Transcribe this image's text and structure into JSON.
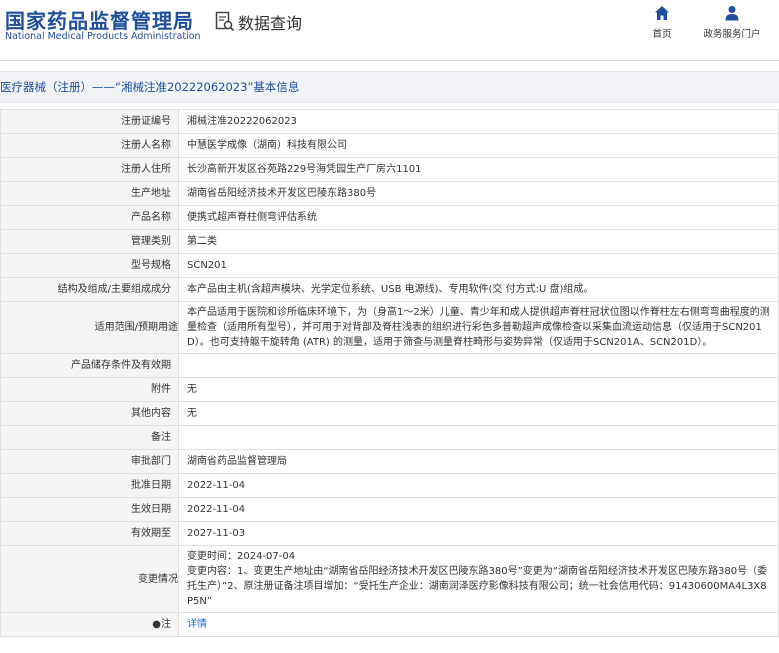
{
  "header": {
    "logo_cn": "国家药品监督管理局",
    "logo_en": "National Medical Products Administration",
    "query_title": "数据查询",
    "nav": [
      {
        "label": "首页",
        "icon": "home-icon"
      },
      {
        "label": "政务服务门户",
        "icon": "user-icon"
      }
    ]
  },
  "breadcrumb": "医疗器械（注册）——“湘械注准20222062023”基本信息",
  "colors": {
    "brand": "#1f4e9c",
    "link": "#1f6fd1",
    "label_bg": "#f5f5f5"
  },
  "rows": [
    {
      "label": "注册证编号",
      "value": "湘械注准20222062023"
    },
    {
      "label": "注册人名称",
      "value": "中慧医学成像（湖南）科技有限公司"
    },
    {
      "label": "注册人住所",
      "value": "长沙高新开发区谷苑路229号海凭园生产厂房六1101"
    },
    {
      "label": "生产地址",
      "value": "湖南省岳阳经济技术开发区巴陵东路380号"
    },
    {
      "label": "产品名称",
      "value": "便携式超声脊柱侧弯评估系统"
    },
    {
      "label": "管理类别",
      "value": "第二类"
    },
    {
      "label": "型号规格",
      "value": "SCN201"
    },
    {
      "label": "结构及组成/主要组成成分",
      "value": "本产品由主机(含超声模块、光学定位系统、USB 电源线)、专用软件(交 付方式:U 盘)组成。"
    },
    {
      "label": "适用范围/预期用途",
      "value": "本产品适用于医院和诊所临床环境下，为（身高1～2米）儿童、青少年和成人提供超声脊柱冠状位图以作脊柱左右侧弯弯曲程度的测量检查（适用所有型号），并可用于对背部及脊柱浅表的组织进行彩色多普勒超声成像检查以采集血流运动信息（仅适用于SCN201D）。也可支持躯干旋转角 (ATR) 的测量，适用于筛查与测量脊柱畸形与姿势异常（仅适用于SCN201A、SCN201D）。"
    },
    {
      "label": "产品储存条件及有效期",
      "value": ""
    },
    {
      "label": "附件",
      "value": "无"
    },
    {
      "label": "其他内容",
      "value": "无"
    },
    {
      "label": "备注",
      "value": ""
    },
    {
      "label": "审批部门",
      "value": "湖南省药品监督管理局"
    },
    {
      "label": "批准日期",
      "value": "2022-11-04"
    },
    {
      "label": "生效日期",
      "value": "2022-11-04"
    },
    {
      "label": "有效期至",
      "value": "2027-11-03"
    }
  ],
  "change": {
    "label": "变更情况",
    "time": "变更时间：2024-07-04",
    "content": "变更内容：1、变更生产地址由“湖南省岳阳经济技术开发区巴陵东路380号”变更为“湖南省岳阳经济技术开发区巴陵东路380号（委托生产）”2、原注册证备注项目增加：“受托生产企业：湖南润泽医疗影像科技有限公司；统一社会信用代码：91430600MA4L3X8P5N”"
  },
  "note_row": {
    "label": "●注",
    "link": "详情"
  }
}
